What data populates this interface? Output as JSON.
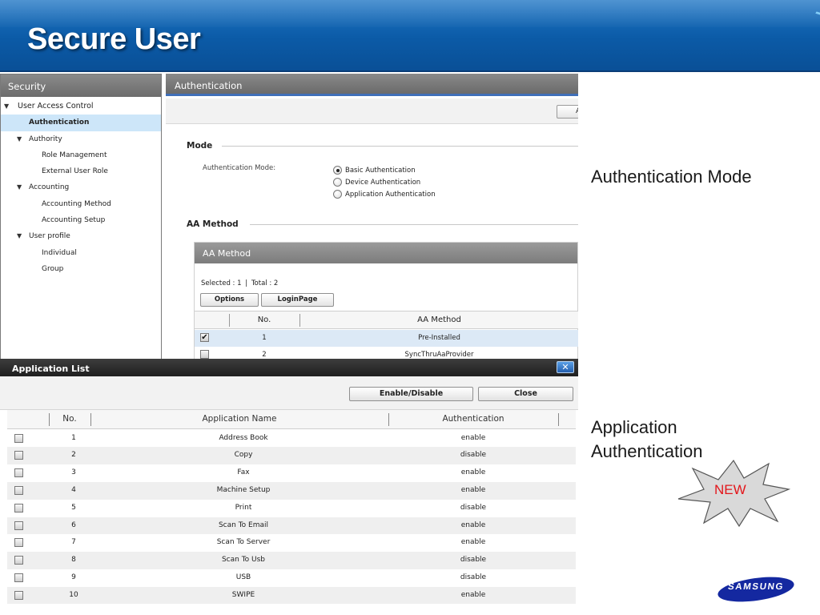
{
  "slide": {
    "title": "Secure User",
    "annotation_mode": "Authentication Mode",
    "annotation_app_line1": "Application",
    "annotation_app_line2": "Authentication",
    "new_badge": "NEW",
    "brand": "SAMSUNG"
  },
  "sidebar": {
    "header": "Security",
    "items": [
      {
        "label": "User Access Control",
        "level": 0,
        "expanded": true
      },
      {
        "label": "Authentication",
        "level": 1,
        "selected": true
      },
      {
        "label": "Authority",
        "level": 1,
        "expanded": true
      },
      {
        "label": "Role Management",
        "level": 2
      },
      {
        "label": "External User Role",
        "level": 2
      },
      {
        "label": "Accounting",
        "level": 1,
        "expanded": true
      },
      {
        "label": "Accounting Method",
        "level": 2
      },
      {
        "label": "Accounting Setup",
        "level": 2
      },
      {
        "label": "User profile",
        "level": 1,
        "expanded": true
      },
      {
        "label": "Individual",
        "level": 2
      },
      {
        "label": "Group",
        "level": 2
      }
    ]
  },
  "auth": {
    "header": "Authentication",
    "toolbar_button": "A",
    "mode_section": "Mode",
    "mode_label": "Authentication Mode:",
    "mode_options": [
      {
        "label": "Basic Authentication",
        "checked": true
      },
      {
        "label": "Device Authentication",
        "checked": false
      },
      {
        "label": "Application Authentication",
        "checked": false
      }
    ],
    "aa_section": "AA Method",
    "aa_box_title": "AA Method",
    "aa_selected_text": "Selected : 1",
    "aa_total_text": "Total : 2",
    "options_button": "Options",
    "loginpage_button": "LoginPage",
    "columns": {
      "no": "No.",
      "method": "AA Method"
    },
    "rows": [
      {
        "no": "1",
        "method": "Pre-Installed",
        "checked": true
      },
      {
        "no": "2",
        "method": "SyncThruAaProvider",
        "checked": false
      }
    ]
  },
  "app_list": {
    "title": "Application List",
    "close_x": "✕",
    "enable_disable_button": "Enable/Disable",
    "close_button": "Close",
    "columns": {
      "no": "No.",
      "name": "Application Name",
      "auth": "Authentication"
    },
    "rows": [
      {
        "no": "1",
        "name": "Address Book",
        "auth": "enable"
      },
      {
        "no": "2",
        "name": "Copy",
        "auth": "disable"
      },
      {
        "no": "3",
        "name": "Fax",
        "auth": "enable"
      },
      {
        "no": "4",
        "name": "Machine Setup",
        "auth": "enable"
      },
      {
        "no": "5",
        "name": "Print",
        "auth": "disable"
      },
      {
        "no": "6",
        "name": "Scan To Email",
        "auth": "enable"
      },
      {
        "no": "7",
        "name": "Scan To Server",
        "auth": "enable"
      },
      {
        "no": "8",
        "name": "Scan To Usb",
        "auth": "disable"
      },
      {
        "no": "9",
        "name": "USB",
        "auth": "disable"
      },
      {
        "no": "10",
        "name": "SWIPE",
        "auth": "enable"
      }
    ]
  },
  "colors": {
    "header_blue": "#0b5aa6",
    "selection_blue": "#cde6f9",
    "new_red": "#e3161b",
    "brand_blue": "#1428a0"
  }
}
